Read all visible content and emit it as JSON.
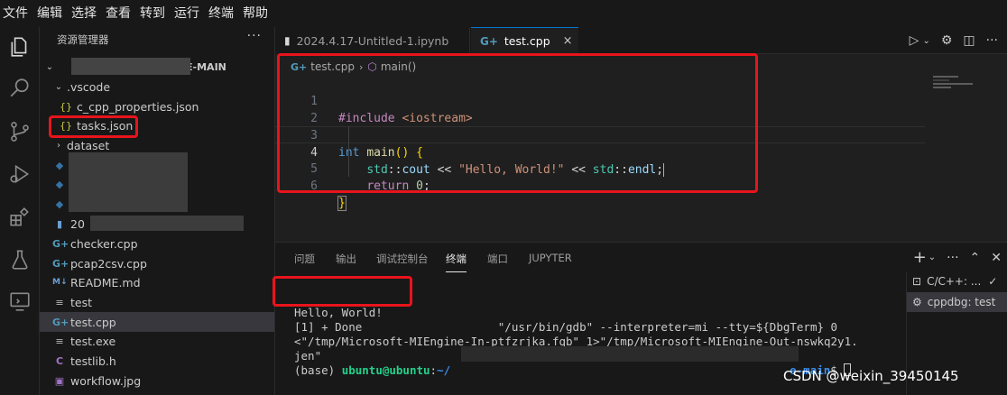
{
  "menubar": [
    "文件",
    "编辑",
    "选择",
    "查看",
    "转到",
    "运行",
    "终端",
    "帮助"
  ],
  "sidebar": {
    "title": "资源管理器",
    "more": "···",
    "root_label_visible": "GE-MAIN",
    "items": [
      {
        "label": ".vscode",
        "kind": "folder-open"
      },
      {
        "label": "c_cpp_properties.json",
        "icon": "{}"
      },
      {
        "label": "tasks.json",
        "icon": "{}"
      },
      {
        "label": "dataset",
        "kind": "folder"
      },
      {
        "label": "20",
        "icon": "py"
      },
      {
        "label": "checker.cpp",
        "icon": "G+"
      },
      {
        "label": "pcap2csv.cpp",
        "icon": "G+"
      },
      {
        "label": "README.md",
        "icon": "M↓"
      },
      {
        "label": "test",
        "icon": "≡"
      },
      {
        "label": "test.cpp",
        "icon": "G+"
      },
      {
        "label": "test.exe",
        "icon": "≡"
      },
      {
        "label": "testlib.h",
        "icon": "C"
      },
      {
        "label": "workflow.jpg",
        "icon": "img"
      }
    ]
  },
  "tabs": {
    "inactive": {
      "label": "2024.4.17-Untitled-1.ipynb"
    },
    "active": {
      "label": "test.cpp",
      "close": "×"
    }
  },
  "breadcrumb": {
    "file": "test.cpp",
    "symbol": "main()"
  },
  "code": {
    "line_numbers": [
      "1",
      "2",
      "3",
      "4",
      "5",
      "6"
    ],
    "current_line": 4
  },
  "panel": {
    "tabs": [
      "问题",
      "输出",
      "调试控制台",
      "终端",
      "端口",
      "JUPYTER"
    ],
    "active_tab": "终端",
    "terminal": {
      "line1": "Hello, World!",
      "line2": "[1] + Done                    \"/usr/bin/gdb\" --interpreter=mi --tty=${DbgTerm} 0",
      "line3": "<\"/tmp/Microsoft-MIEngine-In-ptfzrjka.fqb\" 1>\"/tmp/Microsoft-MIEngine-Out-nswkq2y1.",
      "line4": "jen\"",
      "prompt_env": "(base) ",
      "prompt_user": "ubuntu@ubuntu",
      "prompt_colon": ":",
      "prompt_path_start": "~/",
      "prompt_path_end": "e-main",
      "prompt_dollar": "$ "
    },
    "terminal_list": [
      {
        "label": "C/C++: ...",
        "icon": "terminal-icon"
      },
      {
        "label": "cppdbg: test",
        "icon": "gear-icon"
      }
    ]
  },
  "watermark": "CSDN @weixin_39450145",
  "colors": {
    "highlight_box": "#e8141c",
    "accent": "#0078d4"
  }
}
